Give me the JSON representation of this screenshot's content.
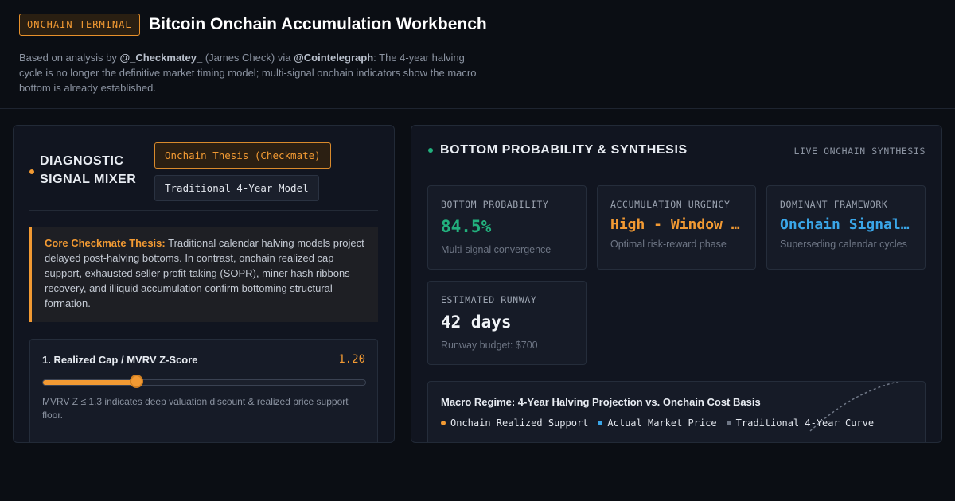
{
  "header": {
    "badge": "ONCHAIN TERMINAL",
    "title": "Bitcoin Onchain Accumulation Workbench",
    "subtitle": {
      "prefix": "Based on analysis by ",
      "author_handle": "@_Checkmatey_",
      "author_name": " (James Check) via ",
      "source_handle": "@Cointelegraph",
      "summary": ": The 4-year halving cycle is no longer the definitive market timing model; multi-signal onchain indicators show the macro bottom is already established."
    }
  },
  "mixer": {
    "title": "DIAGNOSTIC SIGNAL MIXER",
    "toggles": [
      {
        "label": "Onchain Thesis (Checkmate)",
        "active": true
      },
      {
        "label": "Traditional 4-Year Model",
        "active": false
      }
    ],
    "thesis": {
      "lead": "Core Checkmate Thesis:",
      "body": " Traditional calendar halving models project delayed post-halving bottoms. In contrast, onchain realized cap support, exhausted seller profit-taking (SOPR), miner hash ribbons recovery, and illiquid accumulation confirm bottoming structural formation."
    },
    "metrics": [
      {
        "label": "1. Realized Cap / MVRV Z-Score",
        "value": "1.20",
        "slider_fraction": 0.29,
        "note": "MVRV Z ≤ 1.3 indicates deep valuation discount & realized price support floor."
      }
    ]
  },
  "synthesis": {
    "title": "BOTTOM PROBABILITY & SYNTHESIS",
    "status": "LIVE ONCHAIN SYNTHESIS",
    "cards": [
      {
        "label": "BOTTOM PROBABILITY",
        "value": "84.5%",
        "note": "Multi-signal convergence",
        "color": "#22b07d"
      },
      {
        "label": "ACCUMULATION URGENCY",
        "value": "High - Window Closing",
        "note": "Optimal risk-reward phase",
        "color": "#f29a33"
      },
      {
        "label": "DOMINANT FRAMEWORK",
        "value": "Onchain Signals Dominant",
        "note": "Superseding calendar cycles",
        "color": "#3aa6e8"
      },
      {
        "label": "ESTIMATED RUNWAY",
        "value": "42 days",
        "note": "Runway budget: $700",
        "color": "#f1f4f8"
      }
    ],
    "regime": {
      "title": "Macro Regime: 4-Year Halving Projection vs. Onchain Cost Basis",
      "legend": [
        {
          "label": "Onchain Realized Support",
          "color": "#f29a33"
        },
        {
          "label": "Actual Market Price",
          "color": "#3aa6e8"
        },
        {
          "label": "Traditional 4-Year Curve",
          "color": "#6e7685"
        }
      ]
    }
  }
}
